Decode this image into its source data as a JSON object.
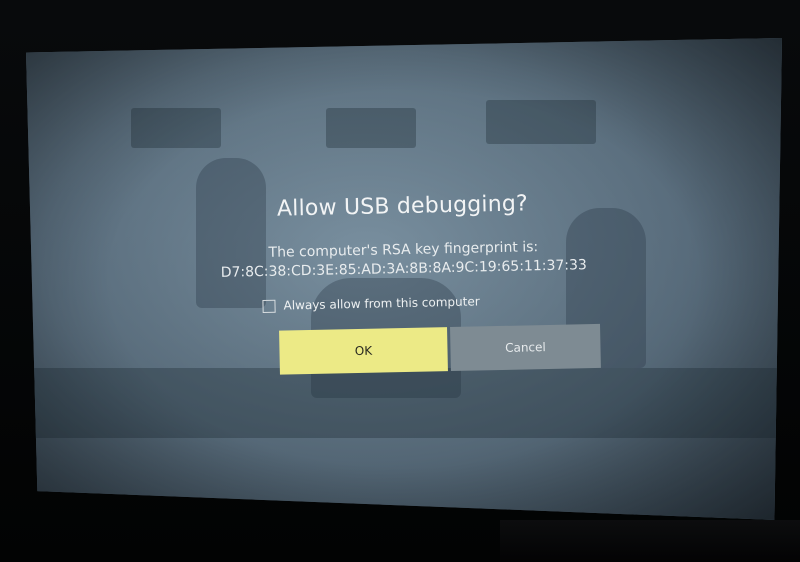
{
  "dialog": {
    "title": "Allow USB debugging?",
    "message_line1": "The computer's RSA key fingerprint is:",
    "fingerprint": "D7:8C:38:CD:3E:85:AD:3A:8B:8A:9C:19:65:11:37:33",
    "checkbox_label": "Always allow from this computer",
    "checkbox_checked": false,
    "ok_label": "OK",
    "cancel_label": "Cancel"
  },
  "colors": {
    "ok_button": "#ecea86",
    "cancel_button": "#7e8b93",
    "overlay": "#56697a"
  }
}
